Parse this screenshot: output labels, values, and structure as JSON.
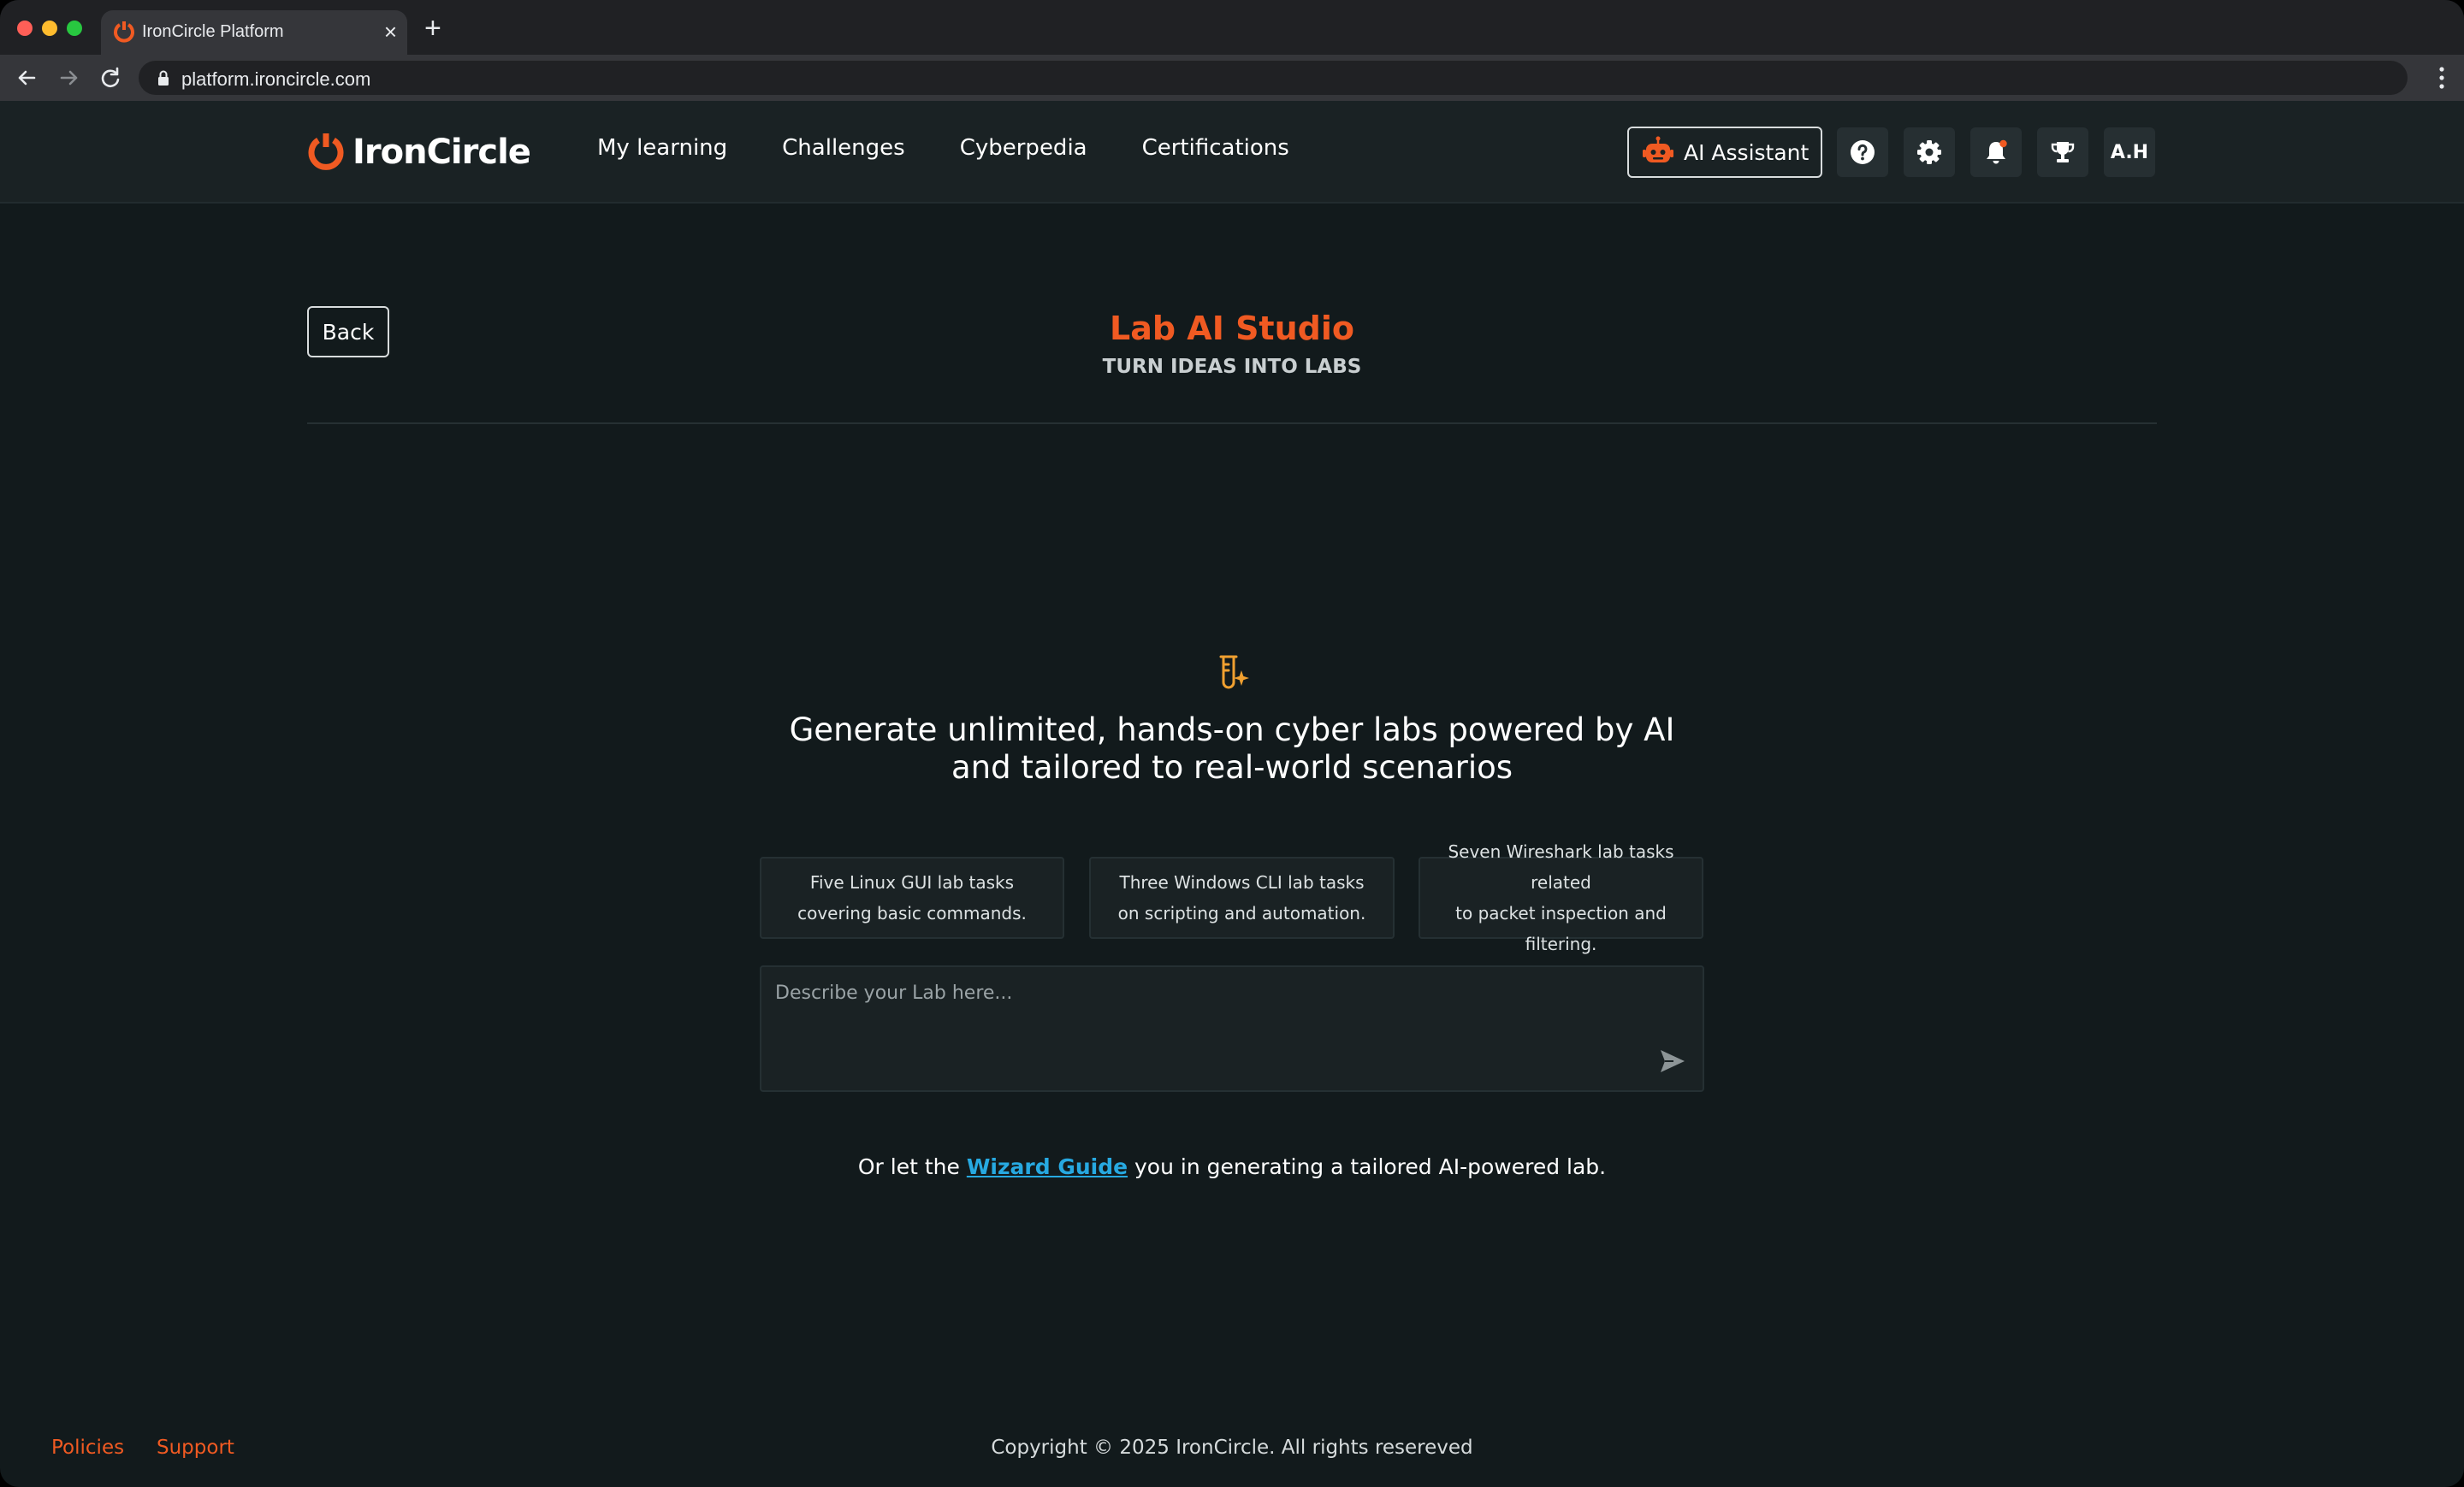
{
  "browser": {
    "tab_title": "IronCircle Platform",
    "url": "platform.ironcircle.com",
    "new_tab_label": "+",
    "close_label": "×"
  },
  "header": {
    "brand": "IronCircle",
    "nav": [
      "My learning",
      "Challenges",
      "Cyberpedia",
      "Certifications"
    ],
    "ai_assistant_label": "AI Assistant",
    "avatar_initials": "A.H",
    "icons": [
      "help-icon",
      "settings-icon",
      "notification-bell-icon",
      "trophy-icon"
    ],
    "notification_dot_color": "#f05a22"
  },
  "page": {
    "back_label": "Back",
    "title": "Lab AI Studio",
    "subtitle": "TURN IDEAS INTO LABS",
    "hero_line1": "Generate unlimited, hands-on cyber labs powered by AI",
    "hero_line2": "and tailored to real-world scenarios",
    "suggestions": [
      {
        "line1": "Five Linux GUI lab tasks",
        "line2": "covering basic commands."
      },
      {
        "line1": "Three Windows CLI lab tasks",
        "line2": "on scripting and automation."
      },
      {
        "line1": "Seven Wireshark lab tasks related",
        "line2": "to packet inspection and filtering."
      }
    ],
    "composer_placeholder": "Describe your Lab here...",
    "wizard_prefix": "Or let the ",
    "wizard_link": "Wizard Guide",
    "wizard_suffix": " you in generating a tailored AI-powered lab."
  },
  "footer": {
    "policies": "Policies",
    "support": "Support",
    "copyright": "Copyright © 2025 IronCircle. All rights resereved"
  },
  "colors": {
    "accent": "#f05a22",
    "link": "#27a9e1",
    "background": "#121a1c",
    "header_bg": "#1a2224"
  }
}
